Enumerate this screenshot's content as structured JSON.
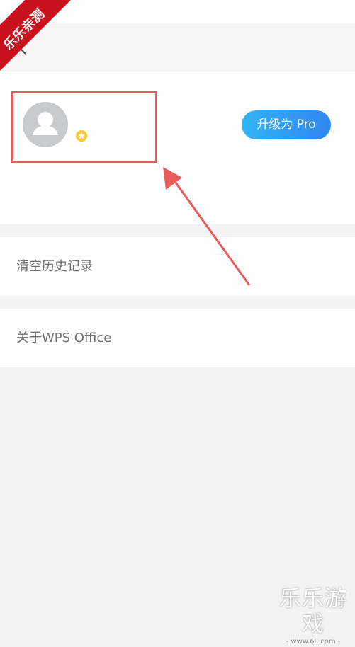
{
  "header": {
    "back_icon": "chevron-left-icon"
  },
  "profile": {
    "avatar_icon": "user-avatar-icon",
    "badge_icon": "star-badge-icon",
    "upgrade_label": "升级为 Pro"
  },
  "menu": {
    "items": [
      {
        "label": "清空历史记录"
      },
      {
        "label": "关于WPS Office"
      }
    ]
  },
  "watermark": {
    "corner_text": "乐乐亲测",
    "footer_title": "乐乐游戏",
    "footer_url": "- www.6ll.com -"
  },
  "colors": {
    "accent_start": "#33b4f7",
    "accent_end": "#2f86f0",
    "highlight": "#e95a5a",
    "badge": "#f7c83a"
  }
}
